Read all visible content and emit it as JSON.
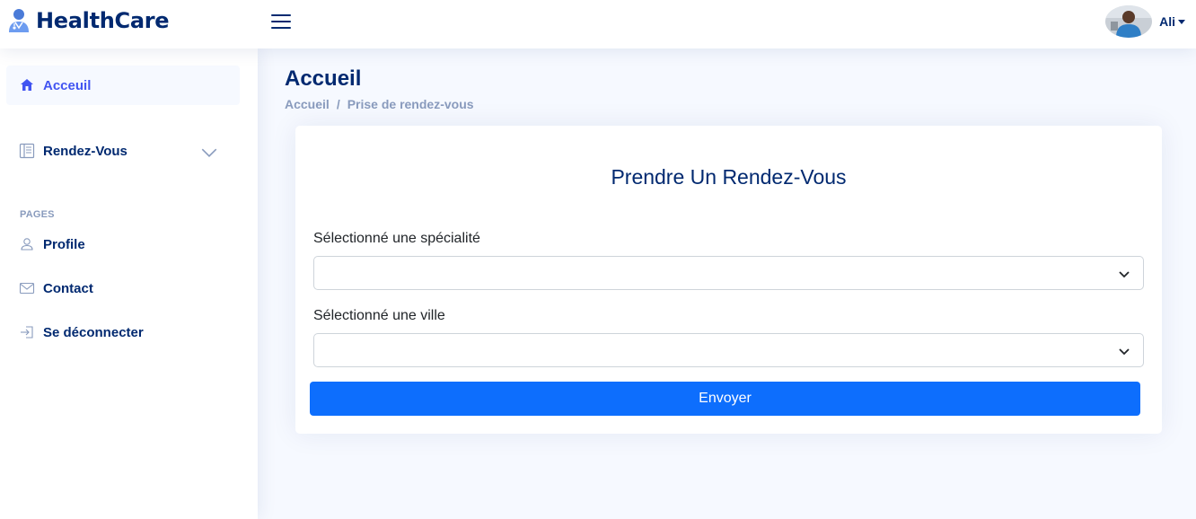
{
  "app": {
    "name": "HealthCare"
  },
  "header": {
    "user_name": "Ali"
  },
  "sidebar": {
    "items": [
      {
        "label": "Acceuil",
        "icon": "home-icon",
        "active": true
      },
      {
        "label": "Rendez-Vous",
        "icon": "layout-text-icon",
        "expandable": true
      }
    ],
    "pages_heading": "PAGES",
    "pages": [
      {
        "label": "Profile",
        "icon": "person-icon"
      },
      {
        "label": "Contact",
        "icon": "envelope-icon"
      },
      {
        "label": "Se déconnecter",
        "icon": "box-arrow-in-right-icon"
      }
    ]
  },
  "page": {
    "title": "Accueil",
    "breadcrumb": [
      "Accueil",
      "Prise de rendez-vous"
    ]
  },
  "form": {
    "title": "Prendre Un Rendez-Vous",
    "specialty_label": "Sélectionné une spécialité",
    "specialty_value": "",
    "city_label": "Sélectionné une ville",
    "city_value": "",
    "submit_label": "Envoyer"
  },
  "colors": {
    "brand": "#012970",
    "accent": "#4154f1",
    "primary_button": "#0d6efd",
    "background": "#f6f9ff"
  }
}
